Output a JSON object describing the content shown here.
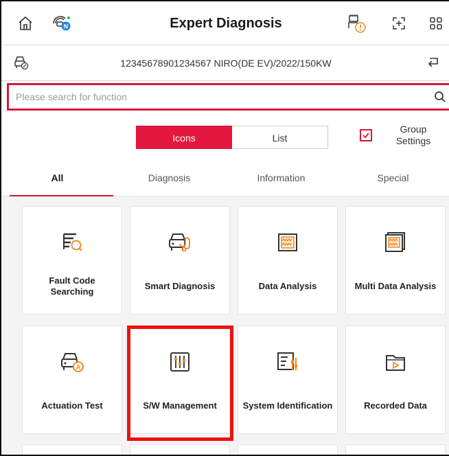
{
  "header": {
    "title": "Expert Diagnosis"
  },
  "vehicle": {
    "info": "12345678901234567  NIRO(DE EV)/2022/150KW"
  },
  "search": {
    "placeholder": "Please search for function"
  },
  "view_toggle": {
    "icons_label": "Icons",
    "list_label": "List",
    "selected": "Icons"
  },
  "group_settings": {
    "label": "Group Settings",
    "checked": true
  },
  "tabs": [
    {
      "label": "All",
      "active": true
    },
    {
      "label": "Diagnosis",
      "active": false
    },
    {
      "label": "Information",
      "active": false
    },
    {
      "label": "Special",
      "active": false
    }
  ],
  "functions": [
    {
      "label": "Fault Code Searching",
      "icon": "fault-code-search-icon"
    },
    {
      "label": "Smart Diagnosis",
      "icon": "smart-diagnosis-icon"
    },
    {
      "label": "Data Analysis",
      "icon": "data-analysis-icon"
    },
    {
      "label": "Multi Data Analysis",
      "icon": "multi-data-analysis-icon"
    },
    {
      "label": "Actuation Test",
      "icon": "actuation-test-icon"
    },
    {
      "label": "S/W Management",
      "icon": "sw-management-icon",
      "highlighted": true
    },
    {
      "label": "System Identification",
      "icon": "system-identification-icon"
    },
    {
      "label": "Recorded Data",
      "icon": "recorded-data-icon"
    }
  ],
  "colors": {
    "accent": "#e3173e",
    "highlight": "#ee1111",
    "badge_blue": "#1e88e5",
    "icon_orange": "#f08a24"
  }
}
